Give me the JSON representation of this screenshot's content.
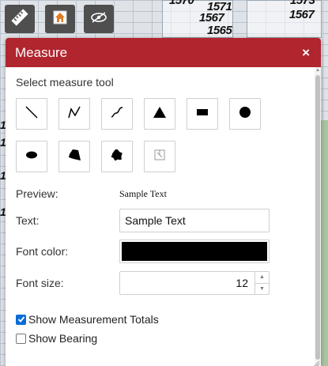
{
  "map": {
    "lot_numbers": [
      "1570",
      "1571",
      "1567",
      "1565",
      "1573",
      "1567"
    ],
    "left_numbers": [
      "1",
      "1",
      "1",
      "1"
    ]
  },
  "toolbar": {
    "items": [
      {
        "name": "measure-ruler-button",
        "icon": "ruler-icon"
      },
      {
        "name": "home-button",
        "icon": "home-icon"
      },
      {
        "name": "hide-layer-button",
        "icon": "eye-slash-icon"
      }
    ]
  },
  "panel": {
    "title": "Measure",
    "close_label": "×",
    "section_label": "Select measure tool",
    "tools": [
      {
        "name": "line-tool",
        "icon": "line-icon"
      },
      {
        "name": "polyline-tool",
        "icon": "polyline-icon"
      },
      {
        "name": "freehand-line-tool",
        "icon": "freehand-line-icon"
      },
      {
        "name": "triangle-tool",
        "icon": "triangle-icon"
      },
      {
        "name": "rectangle-tool",
        "icon": "rectangle-icon"
      },
      {
        "name": "circle-tool",
        "icon": "circle-icon"
      },
      {
        "name": "ellipse-tool",
        "icon": "ellipse-icon"
      },
      {
        "name": "polygon-tool",
        "icon": "polygon-icon"
      },
      {
        "name": "freehand-polygon-tool",
        "icon": "freehand-polygon-icon"
      },
      {
        "name": "text-tool",
        "icon": "text-icon"
      }
    ],
    "preview_label": "Preview:",
    "preview_text": "Sample Text",
    "text_label": "Text:",
    "text_value": "Sample Text",
    "font_color_label": "Font color:",
    "font_color": "#000000",
    "font_size_label": "Font size:",
    "font_size_value": "12",
    "show_totals_label": "Show Measurement Totals",
    "show_totals_checked": true,
    "show_bearing_label": "Show Bearing",
    "show_bearing_checked": false
  },
  "colors": {
    "header": "#b0252e",
    "toolbar_button": "#4f4f4f",
    "checkbox_accent": "#0a6cd6"
  }
}
